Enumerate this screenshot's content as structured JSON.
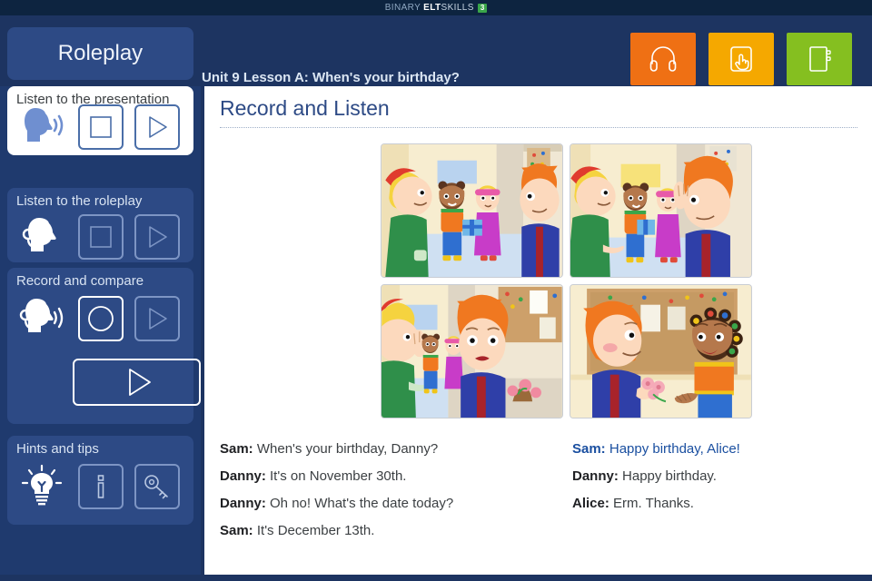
{
  "brand": {
    "part1": "BINARY ",
    "part2": "ELT",
    "part3": "SKILLS",
    "badge": "3"
  },
  "header": {
    "tab_label": "Roleplay",
    "lesson_title": "Unit 9 Lesson A: When's your birthday?",
    "tools": [
      {
        "name": "headphones-button",
        "label": "Listen",
        "color": "#ef7014"
      },
      {
        "name": "practice-button",
        "label": "Practise",
        "color": "#f5a800"
      },
      {
        "name": "notebook-button",
        "label": "Notebook",
        "color": "#85bf20"
      }
    ]
  },
  "sidebar": {
    "cards": [
      {
        "title": "Listen to the presentation",
        "active": true,
        "avatar": "speaking-head-icon",
        "buttons": [
          {
            "name": "stop-button",
            "icon": "square",
            "state": "enabled"
          },
          {
            "name": "play-button",
            "icon": "triangle",
            "state": "enabled"
          }
        ]
      },
      {
        "title": "Listen to the roleplay",
        "active": false,
        "avatar": "headset-head-icon",
        "buttons": [
          {
            "name": "stop-button",
            "icon": "square",
            "state": "disabled"
          },
          {
            "name": "play-button",
            "icon": "triangle",
            "state": "disabled"
          }
        ]
      },
      {
        "title": "Record and compare",
        "active": false,
        "avatar": "headset-mic-head-icon",
        "buttons": [
          {
            "name": "record-button",
            "icon": "circle",
            "state": "enabled"
          },
          {
            "name": "play-recording-button",
            "icon": "triangle",
            "state": "disabled"
          }
        ],
        "wide_button": {
          "name": "play-all-button",
          "icon": "triangle"
        }
      },
      {
        "title": "Hints and tips",
        "active": false,
        "avatar": "lightbulb-icon",
        "buttons": [
          {
            "name": "info-button",
            "icon": "info",
            "state": "enabled"
          },
          {
            "name": "key-button",
            "icon": "key",
            "state": "enabled"
          }
        ]
      }
    ]
  },
  "main": {
    "title": "Record and Listen",
    "panels": [
      {
        "name": "comic-panel-1",
        "caption": "Sam and Danny greet Mia and Alice in the hallway"
      },
      {
        "name": "comic-panel-2",
        "caption": "Danny raises his hand, surprised"
      },
      {
        "name": "comic-panel-3",
        "caption": "Danny looks worried beside the noticeboard"
      },
      {
        "name": "comic-panel-4",
        "caption": "Danny gives flowers to Alice"
      }
    ],
    "dialogue_left": [
      {
        "speaker": "Sam:",
        "text": "When's your birthday, Danny?",
        "highlight": false
      },
      {
        "speaker": "Danny:",
        "text": "It's on November 30th.",
        "highlight": false
      },
      {
        "speaker": "Danny:",
        "text": "Oh no! What's the date today?",
        "highlight": false
      },
      {
        "speaker": "Sam:",
        "text": "It's December 13th.",
        "highlight": false
      }
    ],
    "dialogue_right": [
      {
        "speaker": "Sam:",
        "text": "Happy birthday, Alice!",
        "highlight": true
      },
      {
        "speaker": "Danny:",
        "text": "Happy birthday.",
        "highlight": false
      },
      {
        "speaker": "Alice:",
        "text": "Erm. Thanks.",
        "highlight": false
      }
    ]
  }
}
